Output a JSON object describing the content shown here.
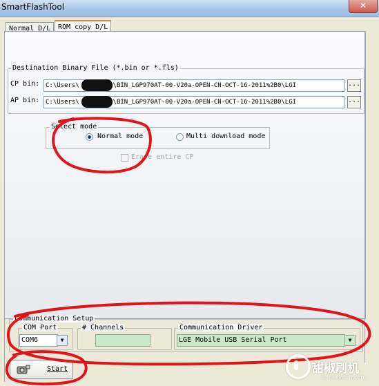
{
  "window": {
    "title": "SmartFlashTool",
    "close_glyph": "✕"
  },
  "tabs": [
    {
      "label": "Normal D/L",
      "active": false
    },
    {
      "label": "ROM copy D/L",
      "active": true
    }
  ],
  "destination": {
    "legend": "Destination Binary File (*.bin or *.fls)",
    "cp_label": "CP bin:",
    "cp_value": "C:\\Users\\        \\Desktop\\BIN_LGP970AT-00-V20a-OPEN-CN-OCT-16-2011%2B0\\LGI",
    "ap_label": "AP bin:",
    "ap_value": "C:\\Users\\        \\Desktop\\BIN_LGP970AT-00-V20a-OPEN-CN-OCT-16-2011%2B0\\LGI",
    "browse_label": "..."
  },
  "select_mode": {
    "legend": "Select mode",
    "normal_label": "Normal mode",
    "multi_label": "Multi download mode",
    "selected": "normal"
  },
  "erase_cp": {
    "label": "Erase entire CP",
    "checked": false,
    "enabled": false
  },
  "comm": {
    "legend": "Communication Setup",
    "com_port_label": "COM Port",
    "com_port_value": "COM6",
    "channels_label": "# Channels",
    "channels_value": "",
    "driver_label": "Communication Driver",
    "driver_value": "LGE Mobile USB Serial Port"
  },
  "start": {
    "label": "Start"
  },
  "watermark": {
    "brand": "甜椒刷机",
    "url": "onekeyrom.com"
  },
  "annotation_color": "#e0151b",
  "colors": {
    "dialog_bg": "#ece9d8",
    "active_tab_accent": "#e68b2c",
    "field_green": "#cde8c9"
  }
}
